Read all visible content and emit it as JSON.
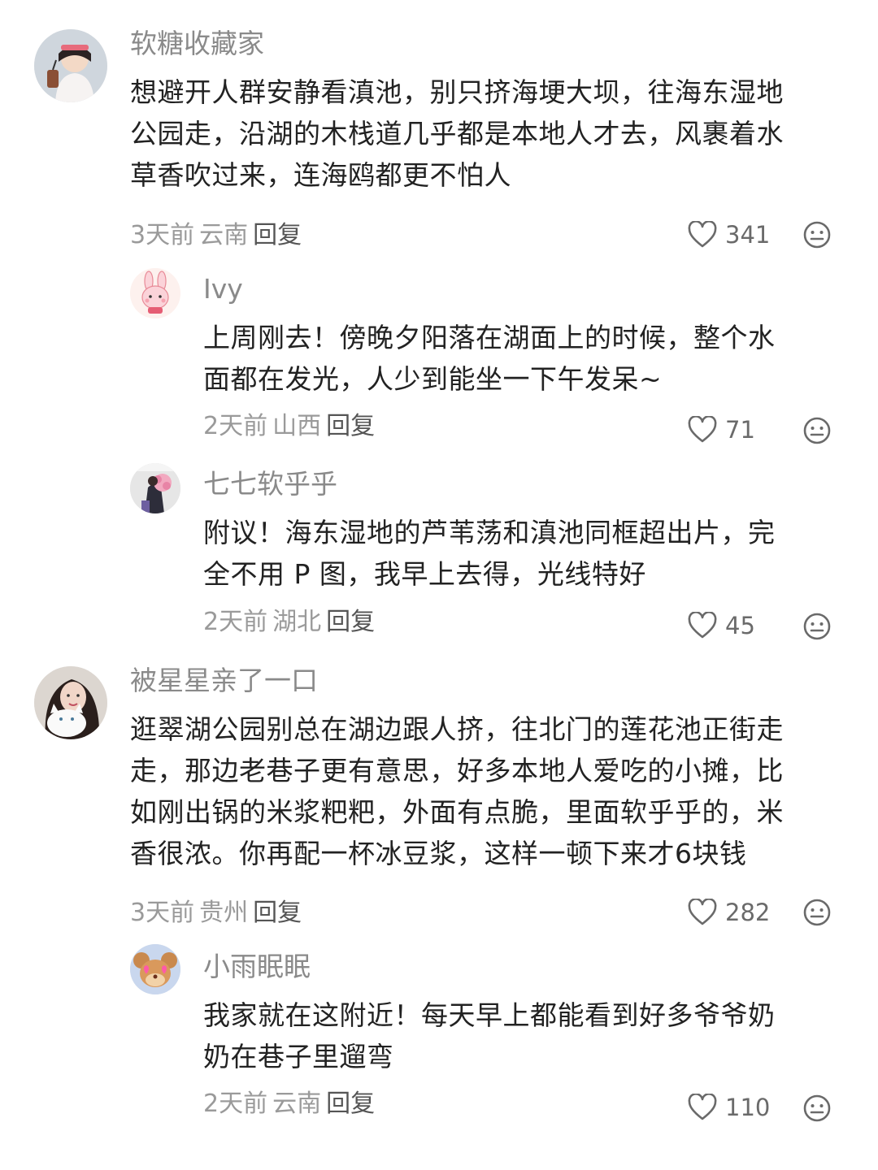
{
  "comments": [
    {
      "user": "软糖收藏家",
      "text_lines": [
        "想避开人群安静看滇池，别只挤海埂大坝，往海东湿地",
        "公园走，沿湖的木栈道几乎都是本地人才去，风裹着水",
        "草香吹过来，连海鸥都更不怕人"
      ],
      "time": "3天前",
      "location": "云南",
      "reply_label": "回复",
      "likes": "341",
      "avatar_icon": "girl-with-drink-avatar",
      "replies": [
        {
          "user": "Ivy",
          "text_lines": [
            "上周刚去！傍晚夕阳落在湖面上的时候，整个水",
            "面都在发光，人少到能坐一下午发呆~"
          ],
          "time": "2天前",
          "location": "山西",
          "reply_label": "回复",
          "likes": "71",
          "avatar_icon": "pink-bunny-avatar"
        },
        {
          "user": "七七软乎乎",
          "text_lines": [
            "附议！海东湿地的芦苇荡和滇池同框超出片，完",
            "全不用 P 图，我早上去得，光线特好"
          ],
          "time": "2天前",
          "location": "湖北",
          "reply_label": "回复",
          "likes": "45",
          "avatar_icon": "girl-with-flowers-avatar"
        }
      ]
    },
    {
      "user": "被星星亲了一口",
      "text_lines": [
        "逛翠湖公园别总在湖边跟人挤，往北门的莲花池正街走",
        "走，那边老巷子更有意思，好多本地人爱吃的小摊，比",
        "如刚出锅的米浆粑粑，外面有点脆，里面软乎乎的，米",
        "香很浓。你再配一杯冰豆浆，这样一顿下来才6块钱"
      ],
      "time": "3天前",
      "location": "贵州",
      "reply_label": "回复",
      "likes": "282",
      "avatar_icon": "girl-with-cat-avatar",
      "replies": [
        {
          "user": "小雨眠眠",
          "text_lines": [
            "我家就在这附近！每天早上都能看到好多爷爷奶",
            "奶在巷子里遛弯"
          ],
          "time": "2天前",
          "location": "云南",
          "reply_label": "回复",
          "likes": "110",
          "avatar_icon": "cartoon-mouse-avatar"
        }
      ]
    }
  ],
  "icons": {
    "like": "heart-outline-icon",
    "emoji": "smiley-face-icon"
  },
  "colors": {
    "username": "#8a8a8a",
    "text": "#222222",
    "meta": "#9a9a9a",
    "reply": "#555555"
  }
}
